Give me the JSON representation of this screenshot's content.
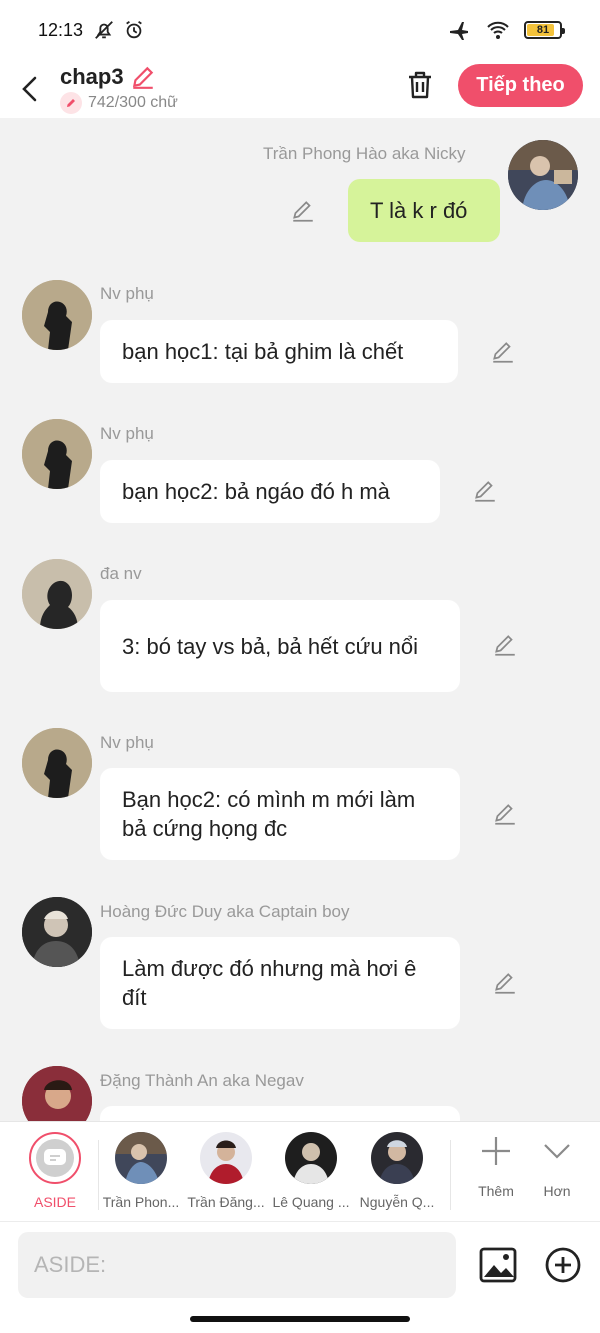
{
  "status": {
    "time": "12:13",
    "battery": "81"
  },
  "header": {
    "title": "chap3",
    "count": "742/300 chữ",
    "next_label": "Tiếp theo"
  },
  "messages": [
    {
      "name": "Trần Phong Hào aka Nicky",
      "text": "T là k r đó",
      "mine": true
    },
    {
      "name": "Nv phụ",
      "text": "bạn học1: tại bả ghim là chết"
    },
    {
      "name": "Nv phụ",
      "text": "bạn học2: bả ngáo đó h mà"
    },
    {
      "name": "đa nv",
      "text": "3: bó tay vs bả, bả hết cứu nổi"
    },
    {
      "name": "Nv phụ",
      "text": "Bạn học2: có mình m mới làm bả cứng họng đc"
    },
    {
      "name": "Hoàng Đức Duy aka Captain boy",
      "text": "Làm được đó nhưng mà hơi ê đít"
    },
    {
      "name": "Đặng Thành An aka Negav",
      "text": ""
    }
  ],
  "picker": {
    "aside_label": "ASIDE",
    "characters": [
      "Trần Phon...",
      "Trần Đăng...",
      "Lê Quang ...",
      "Nguyễn Q..."
    ],
    "more_label": "Thêm",
    "less_label": "Hơn"
  },
  "input": {
    "placeholder": "ASIDE:"
  },
  "colors": {
    "accent": "#f04f6b",
    "mine_bubble": "#d6f39a",
    "background": "#f2f2f2"
  }
}
